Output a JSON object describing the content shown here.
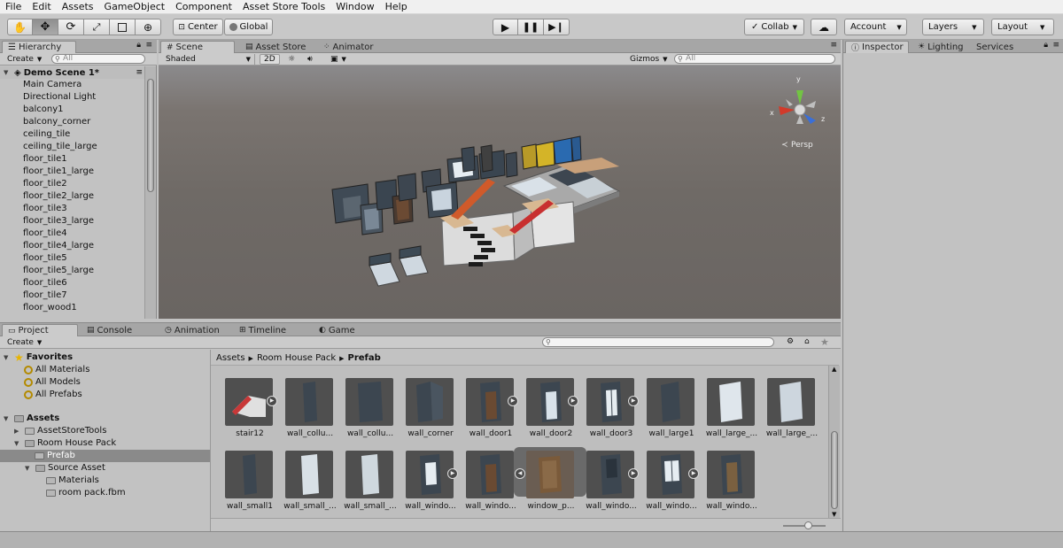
{
  "menu": [
    "File",
    "Edit",
    "Assets",
    "GameObject",
    "Component",
    "Asset Store Tools",
    "Window",
    "Help"
  ],
  "toolbar": {
    "pivot_label": "Center",
    "space_label": "Global",
    "collab_label": "Collab",
    "account_label": "Account",
    "layers_label": "Layers",
    "layout_label": "Layout"
  },
  "hierarchy": {
    "tab": "Hierarchy",
    "create": "Create",
    "search_placeholder": "All",
    "scene_name": "Demo Scene 1*",
    "items": [
      "Main Camera",
      "Directional Light",
      "balcony1",
      "balcony_corner",
      "ceiling_tile",
      "ceiling_tile_large",
      "floor_tile1",
      "floor_tile1_large",
      "floor_tile2",
      "floor_tile2_large",
      "floor_tile3",
      "floor_tile3_large",
      "floor_tile4",
      "floor_tile4_large",
      "floor_tile5",
      "floor_tile5_large",
      "floor_tile6",
      "floor_tile7",
      "floor_wood1"
    ]
  },
  "scene": {
    "tabs": [
      "Scene",
      "Asset Store",
      "Animator"
    ],
    "shading": "Shaded",
    "mode_2d": "2D",
    "gizmos": "Gizmos",
    "search_placeholder": "All",
    "persp_label": "Persp",
    "axis_x": "x",
    "axis_y": "y",
    "axis_z": "z"
  },
  "inspector": {
    "tabs": [
      "Inspector",
      "Lighting",
      "Services"
    ]
  },
  "bottom": {
    "tabs": [
      "Project",
      "Console",
      "Animation",
      "Timeline",
      "Game"
    ],
    "create": "Create",
    "favorites": {
      "title": "Favorites",
      "items": [
        "All Materials",
        "All Models",
        "All Prefabs"
      ]
    },
    "assets_root": "Assets",
    "tree": [
      "AssetStoreTools",
      "Room House Pack",
      "Prefab",
      "Source Asset",
      "Materials",
      "room pack.fbm"
    ],
    "breadcrumb": [
      "Assets",
      "Room House Pack",
      "Prefab"
    ],
    "assets_row1": [
      "stair12",
      "wall_collu...",
      "wall_collu...",
      "wall_corner",
      "wall_door1",
      "wall_door2",
      "wall_door3",
      "wall_large1",
      "wall_large_...",
      "wall_large_..."
    ],
    "assets_row2": [
      "wall_small1",
      "wall_small_...",
      "wall_small_...",
      "wall_windo...",
      "wall_windo...",
      "window_p...",
      "wall_windo...",
      "wall_windo...",
      "wall_windo..."
    ]
  },
  "colors": {
    "panel_bg": "#c2c2c2",
    "selection": "#8a8a8a",
    "viewport": "#6f6a66"
  }
}
